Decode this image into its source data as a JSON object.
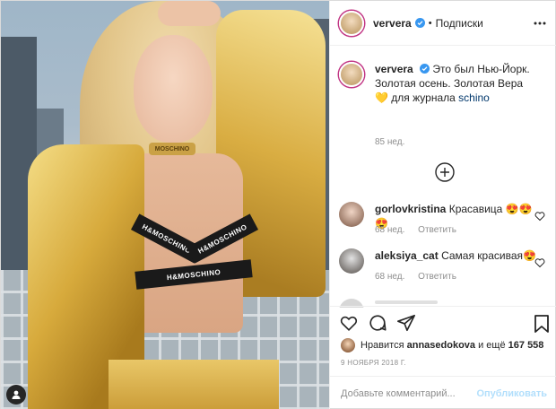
{
  "post": {
    "author": "ververa",
    "verified": true,
    "follow_label": "Подписки",
    "separator": "•"
  },
  "photo": {
    "choker_text": "MOSCHINO",
    "bra_left": "H&MOSCHINO",
    "bra_right": "H&MOSCHINO",
    "bra_low": "H&MOSCHINO"
  },
  "caption": {
    "author": "ververa",
    "text": "Это был Нью-Йорк. Золотая осень. Золотая Вера 💛 для журнала",
    "link": "schino",
    "age": "85 нед."
  },
  "comments": [
    {
      "user": "gorlovkristina",
      "text": "Красавица 😍😍😍",
      "age": "68 нед.",
      "reply": "Ответить",
      "avatar_color": "#c9b6a8"
    },
    {
      "user": "aleksiya_cat",
      "text": "Самая красивая😍",
      "age": "68 нед.",
      "reply": "Ответить",
      "avatar_color": "#b7b0a8"
    }
  ],
  "likes": {
    "prefix": "Нравится",
    "user": "annasedokova",
    "middle": "и ещё",
    "count": "167 558"
  },
  "date": "9 НОЯБРЯ 2018 Г.",
  "composer": {
    "placeholder": "Добавьте комментарий...",
    "publish": "Опубликовать"
  },
  "colors": {
    "verified": "#3897f0",
    "link": "#00376b",
    "muted": "#8e8e8e",
    "publish_disabled": "#b2dffc"
  }
}
